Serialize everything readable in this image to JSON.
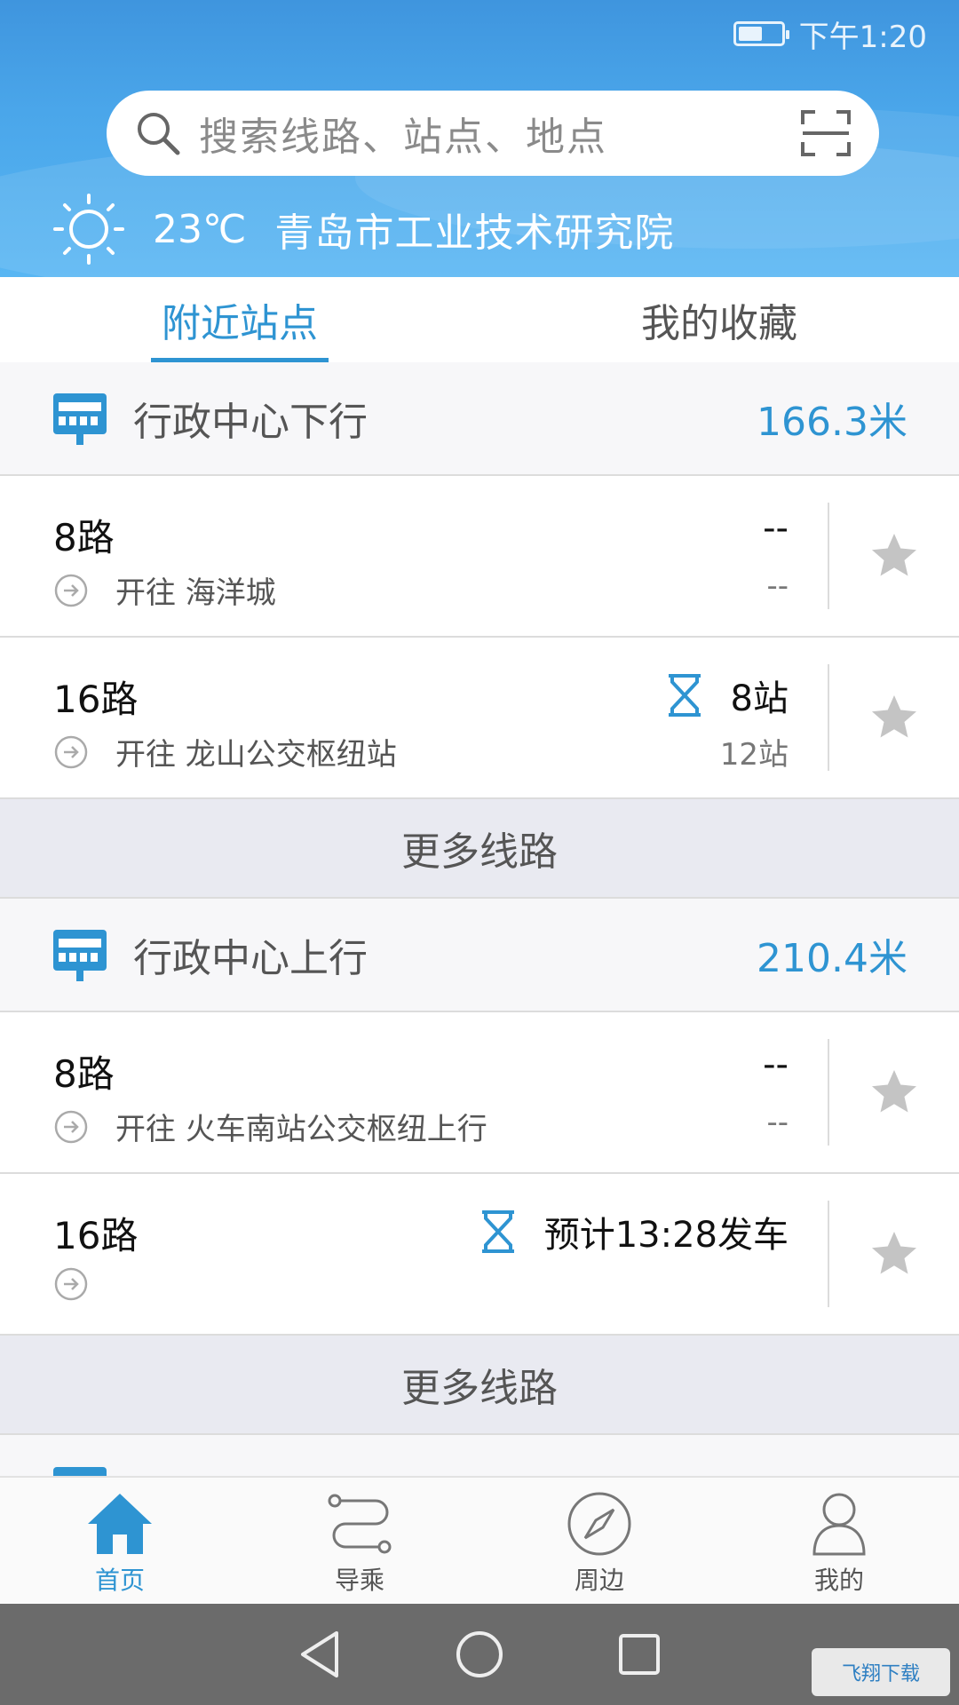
{
  "status_bar": {
    "time": "下午1:20"
  },
  "search": {
    "placeholder": "搜索线路、站点、地点"
  },
  "weather": {
    "temperature": "23℃",
    "location": "青岛市工业技术研究院"
  },
  "tabs": [
    {
      "label": "附近站点",
      "active": true
    },
    {
      "label": "我的收藏",
      "active": false
    }
  ],
  "stations": [
    {
      "name": "行政中心下行",
      "distance": "166.3米",
      "routes": [
        {
          "name": "8路",
          "direction": "开往 海洋城",
          "status_top": "--",
          "status_bottom": "--",
          "waiting_icon": false
        },
        {
          "name": "16路",
          "direction": "开往 龙山公交枢纽站",
          "status_top": "8站",
          "status_bottom": "12站",
          "waiting_icon": true
        }
      ],
      "more_label": "更多线路"
    },
    {
      "name": "行政中心上行",
      "distance": "210.4米",
      "routes": [
        {
          "name": "8路",
          "direction": "开往 火车南站公交枢纽上行",
          "status_top": "--",
          "status_bottom": "--",
          "waiting_icon": false
        },
        {
          "name": "16路",
          "direction": "",
          "status_top": "预计13:28发车",
          "status_bottom": "",
          "waiting_icon": true
        }
      ],
      "more_label": "更多线路"
    }
  ],
  "bottom_nav": [
    {
      "label": "首页",
      "icon": "home-icon",
      "active": true
    },
    {
      "label": "导乘",
      "icon": "route-icon",
      "active": false
    },
    {
      "label": "周边",
      "icon": "compass-icon",
      "active": false
    },
    {
      "label": "我的",
      "icon": "user-icon",
      "active": false
    }
  ],
  "watermark": "飞翔下载",
  "colors": {
    "accent": "#2e94d2",
    "header": "#4aa6ea",
    "star": "#c4c4c4"
  }
}
